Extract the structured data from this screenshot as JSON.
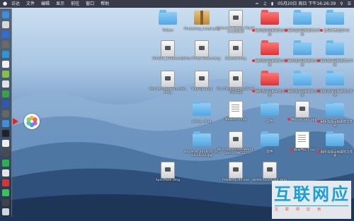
{
  "menubar": {
    "menus": [
      "访达",
      "文件",
      "编辑",
      "显示",
      "前往",
      "窗口",
      "帮助"
    ],
    "clock": "05月20日 周日 下午16:26:39"
  },
  "desktop": {
    "icons": [
      {
        "label": "Videos",
        "kind": "folder"
      },
      {
        "label": "Photoshop_install.pkg",
        "kind": "pkg"
      },
      {
        "label": "Cybertek-Racing MacOS-CHIOMA",
        "kind": "dmg"
      },
      {
        "label": "我所选择目前建的文件夹",
        "kind": "folder-red"
      },
      {
        "label": "用所选择目前建的文件夹",
        "kind": "folder"
      },
      {
        "label": "五月神奇发展中文",
        "kind": "folder"
      },
      {
        "label": "WinSP4_1708.tools",
        "kind": "dmg"
      },
      {
        "label": "Polar Photo Editor.dmg",
        "kind": "dmg"
      },
      {
        "label": "Docster.dmg",
        "kind": "dmg"
      },
      {
        "label": "我所选择目前建的文件夹",
        "kind": "folder-red"
      },
      {
        "label": "我所选择目前建的文件夹",
        "kind": "folder"
      },
      {
        "label": "用所选择目前建的文件夹",
        "kind": "folder"
      },
      {
        "label": "Wondershare TunesGo.dmg",
        "kind": "dmg"
      },
      {
        "label": "PopClip.dmg",
        "kind": "dmg"
      },
      {
        "label": "For.The.King.MacOS-ACTIVATED",
        "kind": "dmg"
      },
      {
        "label": "我所选择目前建的文件夹",
        "kind": "folder-red"
      },
      {
        "label": "用所选择目前建的文件夹",
        "kind": "folder"
      },
      {
        "label": "用所选择目前建的文件夹",
        "kind": "folder"
      },
      {
        "label": "proxy...dmg",
        "kind": "folder"
      },
      {
        "label": "Movies...dmg",
        "kind": "doc"
      },
      {
        "label": "软件",
        "kind": "folder"
      },
      {
        "label": "Mousecape.app",
        "kind": "dmg"
      },
      {
        "label": "用所选择目前建的文件夹",
        "kind": "folder"
      },
      {
        "label": "Snipaste_2018-05-20_16-26-23.jpg",
        "kind": "folder"
      },
      {
        "label": "Micro.Machines.World.Seri...YNKTED",
        "kind": "dmg"
      },
      {
        "label": "软件",
        "kind": "folder"
      },
      {
        "label": "NewFile-1.txt",
        "kind": "doc"
      },
      {
        "label": "用所选择目前建的文件夹",
        "kind": "folder"
      },
      {
        "label": "SyncMate.dmg",
        "kind": "dmg"
      },
      {
        "label": "PdaNet4199.exe",
        "kind": "dmg"
      },
      {
        "label": "BetterTouchTool.dmg",
        "kind": "dmg"
      }
    ]
  },
  "watermark": {
    "chars": [
      "互",
      "联",
      "网",
      "应",
      "用"
    ],
    "sub": [
      "互",
      "联",
      "网",
      "应",
      "用"
    ]
  },
  "colors": {
    "accent": "#1a9fd9",
    "arrow": "#e22222"
  }
}
